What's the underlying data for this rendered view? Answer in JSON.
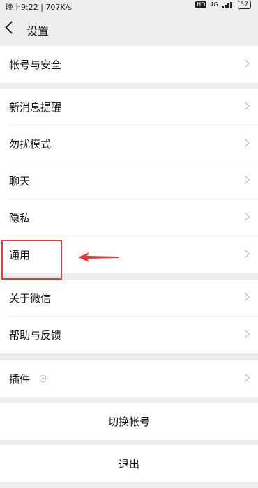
{
  "status_bar": {
    "time_text": "晚上9:22 | 707K/s",
    "hd_label": "HD",
    "network_label": "4G",
    "battery_text": "57"
  },
  "nav": {
    "title": "设置"
  },
  "settings": {
    "account_security": "帐号与安全",
    "new_message_alerts": "新消息提醒",
    "do_not_disturb": "勿扰模式",
    "chat": "聊天",
    "privacy": "隐私",
    "general": "通用",
    "about_wechat": "关于微信",
    "help_feedback": "帮助与反馈",
    "plugins": "插件"
  },
  "actions": {
    "switch_account": "切换帐号",
    "logout": "退出"
  },
  "colors": {
    "background": "#ededed",
    "annotation_red": "#e23b3b",
    "chevron": "#b2b2b2"
  },
  "icons": [
    "back-icon",
    "chevron-right-icon",
    "shield-icon",
    "signal-icon",
    "battery-icon"
  ]
}
